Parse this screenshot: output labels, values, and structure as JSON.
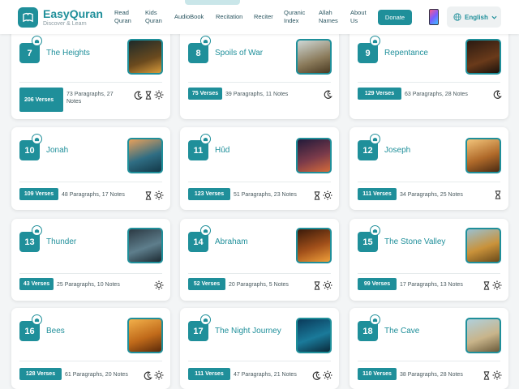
{
  "app": {
    "title": "EasyQuran",
    "subtitle": "Discover & Learn"
  },
  "nav": [
    {
      "line1": "Read",
      "line2": "Quran"
    },
    {
      "line1": "Kids",
      "line2": "Quran"
    },
    {
      "line1": "AudioBook",
      "line2": ""
    },
    {
      "line1": "Recitation",
      "line2": ""
    },
    {
      "line1": "Reciter",
      "line2": ""
    },
    {
      "line1": "Quranic",
      "line2": "Index"
    },
    {
      "line1": "Allah",
      "line2": "Names"
    },
    {
      "line1": "About",
      "line2": "Us"
    }
  ],
  "header": {
    "donate_label": "Donate",
    "language_label": "English"
  },
  "colors": {
    "accent": "#1f8f9a",
    "background": "#f3f5f6"
  },
  "cards": [
    {
      "number": "7",
      "name": "The Heights",
      "verses": "206 Verses",
      "meta": "73 Paragraphs, 27 Notes",
      "icons": [
        "moon-icon",
        "hourglass-icon",
        "sun-icon"
      ]
    },
    {
      "number": "8",
      "name": "Spoils of War",
      "verses": "75 Verses",
      "meta": "39 Paragraphs, 11 Notes",
      "icons": [
        "moon-icon"
      ]
    },
    {
      "number": "9",
      "name": "Repentance",
      "verses": "129 Verses",
      "meta": "63 Paragraphs, 28 Notes",
      "icons": [
        "moon-icon"
      ]
    },
    {
      "number": "10",
      "name": "Jonah",
      "verses": "109 Verses",
      "meta": "48 Paragraphs, 17 Notes",
      "icons": [
        "hourglass-icon",
        "sun-icon"
      ]
    },
    {
      "number": "11",
      "name": "Hûd",
      "verses": "123 Verses",
      "meta": "51 Paragraphs, 23 Notes",
      "icons": [
        "hourglass-icon",
        "sun-icon"
      ]
    },
    {
      "number": "12",
      "name": "Joseph",
      "verses": "111 Verses",
      "meta": "34 Paragraphs, 25 Notes",
      "icons": [
        "hourglass-icon"
      ]
    },
    {
      "number": "13",
      "name": "Thunder",
      "verses": "43 Verses",
      "meta": "25 Paragraphs, 10 Notes",
      "icons": [
        "sun-icon"
      ]
    },
    {
      "number": "14",
      "name": "Abraham",
      "verses": "52 Verses",
      "meta": "20 Paragraphs, 5 Notes",
      "icons": [
        "hourglass-icon",
        "sun-icon"
      ]
    },
    {
      "number": "15",
      "name": "The Stone Valley",
      "verses": "99 Verses",
      "meta": "17 Paragraphs, 13 Notes",
      "icons": [
        "hourglass-icon",
        "sun-icon"
      ]
    },
    {
      "number": "16",
      "name": "Bees",
      "verses": "128 Verses",
      "meta": "61 Paragraphs, 20 Notes",
      "icons": [
        "moon-icon",
        "sun-icon"
      ]
    },
    {
      "number": "17",
      "name": "The Night Journey",
      "verses": "111 Verses",
      "meta": "47 Paragraphs, 21 Notes",
      "icons": [
        "moon-icon",
        "sun-icon"
      ]
    },
    {
      "number": "18",
      "name": "The Cave",
      "verses": "110 Verses",
      "meta": "38 Paragraphs, 28 Notes",
      "icons": [
        "hourglass-icon",
        "sun-icon"
      ]
    }
  ]
}
